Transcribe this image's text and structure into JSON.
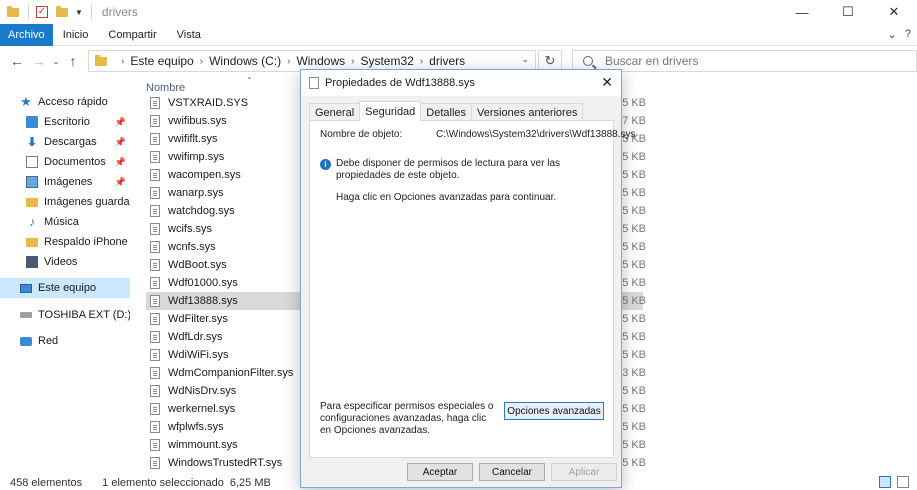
{
  "window": {
    "title": "drivers",
    "controls": [
      "—",
      "☐",
      "✕"
    ]
  },
  "ribbon": {
    "tabs": [
      "Archivo",
      "Inicio",
      "Compartir",
      "Vista"
    ]
  },
  "address": {
    "crumbs": [
      "Este equipo",
      "Windows (C:)",
      "Windows",
      "System32",
      "drivers"
    ],
    "search_placeholder": "Buscar en drivers"
  },
  "navpane": {
    "items": [
      {
        "label": "Acceso rápido",
        "icon": "star-icon",
        "pinned": false
      },
      {
        "label": "Escritorio",
        "icon": "desktop-icon",
        "pinned": true
      },
      {
        "label": "Descargas",
        "icon": "download-icon",
        "pinned": true
      },
      {
        "label": "Documentos",
        "icon": "documents-icon",
        "pinned": true
      },
      {
        "label": "Imágenes",
        "icon": "pictures-icon",
        "pinned": true
      },
      {
        "label": "Imágenes guardadas",
        "icon": "folder-icon",
        "pinned": false
      },
      {
        "label": "Música",
        "icon": "music-icon",
        "pinned": false
      },
      {
        "label": "Respaldo iPhone",
        "icon": "folder-icon",
        "pinned": false
      },
      {
        "label": "Videos",
        "icon": "videos-icon",
        "pinned": false
      },
      {
        "label": "Este equipo",
        "icon": "this-pc-icon",
        "pinned": false
      },
      {
        "label": "TOSHIBA EXT (D:)",
        "icon": "drive-icon",
        "pinned": false
      },
      {
        "label": "Red",
        "icon": "network-icon",
        "pinned": false
      }
    ]
  },
  "filelist": {
    "column_name": "Nombre",
    "files": [
      "VSTXRAID.SYS",
      "vwifibus.sys",
      "vwififlt.sys",
      "vwifimp.sys",
      "wacompen.sys",
      "wanarp.sys",
      "watchdog.sys",
      "wcifs.sys",
      "wcnfs.sys",
      "WdBoot.sys",
      "Wdf01000.sys",
      "Wdf13888.sys",
      "WdFilter.sys",
      "WdfLdr.sys",
      "WdiWiFi.sys",
      "WdmCompanionFilter.sys",
      "WdNisDrv.sys",
      "werkernel.sys",
      "wfplwfs.sys",
      "wimmount.sys",
      "WindowsTrustedRT.sys"
    ],
    "selected_file": "Wdf13888.sys",
    "size_fragments": [
      "KB",
      "KB",
      "KB",
      "KB",
      "KB",
      "KB",
      "KB",
      "KB",
      "KB",
      "KB",
      "KB",
      "KB",
      "KB",
      "KB",
      "KB",
      "KB",
      "KB",
      "KB",
      "KB",
      "KB",
      "KB"
    ],
    "size_digits": [
      "5",
      "7",
      "5",
      "5",
      "5",
      "5",
      "5",
      "5",
      "5",
      "5",
      "5",
      "5",
      "5",
      "5",
      "5",
      "3",
      "5",
      "5",
      "5",
      "5",
      "5"
    ]
  },
  "statusbar": {
    "count": "458 elementos",
    "selection": "1 elemento seleccionado",
    "size": "6,25 MB"
  },
  "dialog": {
    "title": "Propiedades de Wdf13888.sys",
    "tabs": [
      "General",
      "Seguridad",
      "Detalles",
      "Versiones anteriores"
    ],
    "active_tab": "Seguridad",
    "object_label": "Nombre de objeto:",
    "object_value": "C:\\Windows\\System32\\drivers\\Wdf13888.sys",
    "info_text": "Debe disponer de permisos de lectura para ver las propiedades de este objeto.",
    "click_text": "Haga clic en Opciones avanzadas para continuar.",
    "advanced_text": "Para especificar permisos especiales o configuraciones avanzadas, haga clic en Opciones avanzadas.",
    "advanced_button": "Opciones avanzadas",
    "ok_button": "Aceptar",
    "cancel_button": "Cancelar",
    "apply_button": "Aplicar"
  }
}
